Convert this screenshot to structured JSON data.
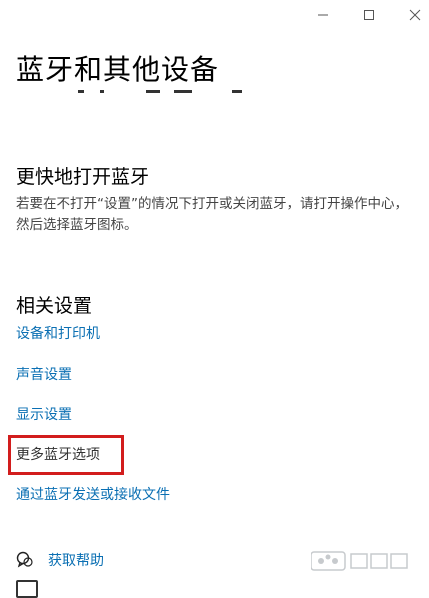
{
  "window": {
    "minimize_icon": "minimize-icon",
    "maximize_icon": "maximize-icon",
    "close_icon": "close-icon"
  },
  "page": {
    "title": "蓝牙和其他设备"
  },
  "quick_section": {
    "title": "更快地打开蓝牙",
    "description": "若要在不打开“设置”的情况下打开或关闭蓝牙，请打开操作中心，然后选择蓝牙图标。"
  },
  "related_section": {
    "title": "相关设置",
    "links": [
      {
        "label": "设备和打印机"
      },
      {
        "label": "声音设置"
      },
      {
        "label": "显示设置"
      },
      {
        "label": "更多蓝牙选项",
        "highlighted": true
      },
      {
        "label": "通过蓝牙发送或接收文件"
      }
    ]
  },
  "help": {
    "get_help_label": "获取帮助",
    "get_help_icon": "chat-help-icon"
  },
  "colors": {
    "link": "#0a6fb3",
    "highlight": "#d21d1d",
    "text": "#000000"
  }
}
